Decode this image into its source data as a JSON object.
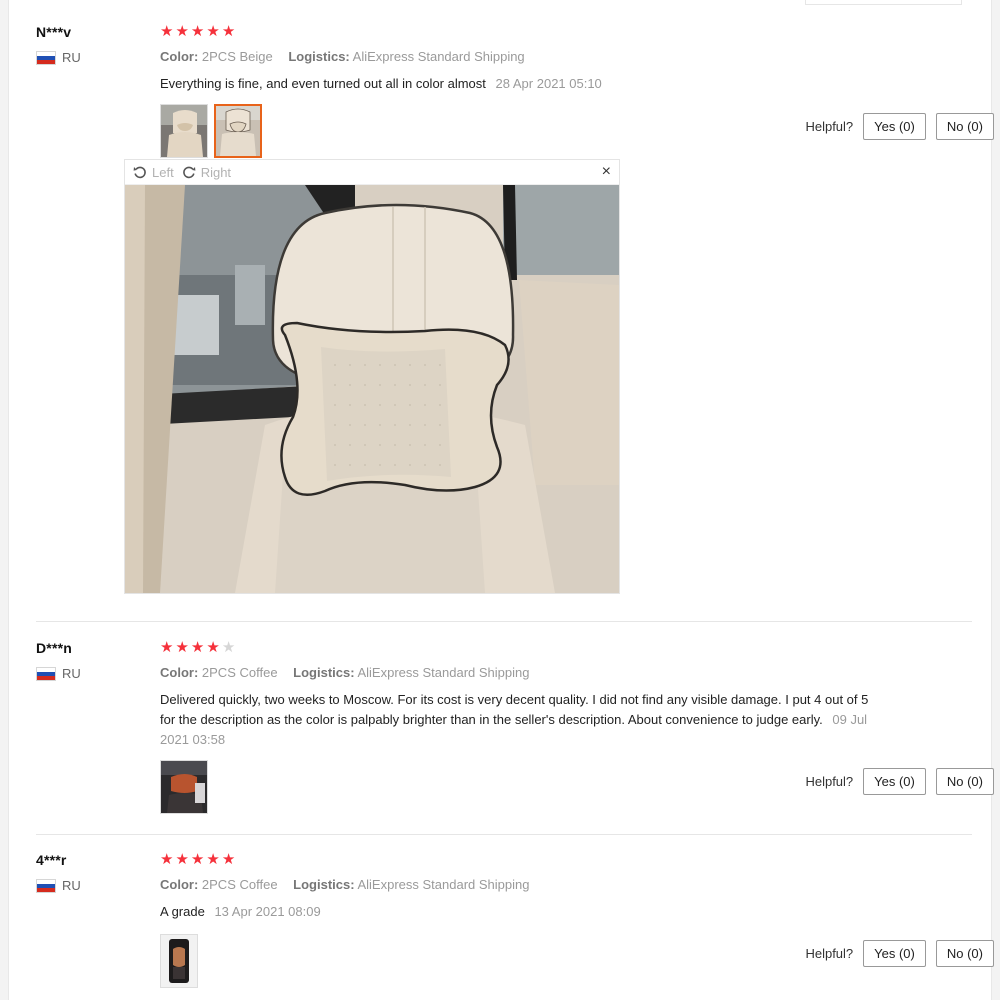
{
  "common": {
    "helpful_label": "Helpful?",
    "color_key": "Color:",
    "logistics_key": "Logistics:",
    "country": "RU",
    "viewer": {
      "left_label": "Left",
      "right_label": "Right",
      "close_glyph": "×"
    }
  },
  "reviews": [
    {
      "user": "N***v",
      "rating": 5,
      "color": "2PCS Beige",
      "logistics": "AliExpress Standard Shipping",
      "text": "Everything is fine, and even turned out all in color almost",
      "date": "28 Apr 2021 05:10",
      "yes": "Yes (0)",
      "no": "No (0)"
    },
    {
      "user": "D***n",
      "rating": 4,
      "color": "2PCS Coffee",
      "logistics": "AliExpress Standard Shipping",
      "text": "Delivered quickly, two weeks to Moscow. For its cost is very decent quality. I did not find any visible damage. I put 4 out of 5 for the description as the color is palpably brighter than in the seller's description. About convenience to judge early.",
      "date": "09 Jul 2021 03:58",
      "yes": "Yes (0)",
      "no": "No (0)"
    },
    {
      "user": "4***r",
      "rating": 5,
      "color": "2PCS Coffee",
      "logistics": "AliExpress Standard Shipping",
      "text": "A grade",
      "date": "13 Apr 2021 08:09",
      "yes": "Yes (0)",
      "no": "No (0)"
    }
  ],
  "colors": {
    "star": "#f5313b",
    "star_off": "#d6d6d6",
    "active_thumb": "#e8631a"
  }
}
